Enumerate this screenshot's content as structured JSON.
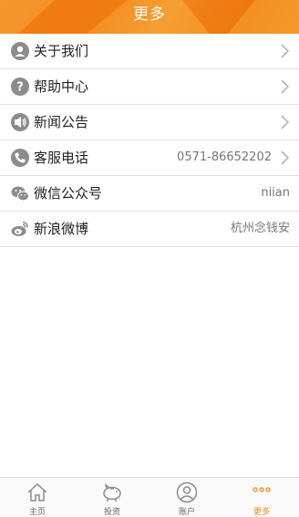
{
  "header": {
    "title": "更多"
  },
  "menu": {
    "items": [
      {
        "label": "关于我们",
        "icon": "about-icon"
      },
      {
        "label": "帮助中心",
        "icon": "help-icon"
      },
      {
        "label": "新闻公告",
        "icon": "announcement-icon"
      },
      {
        "label": "客服电话",
        "value": "0571-86652202",
        "icon": "phone-icon"
      },
      {
        "label": "微信公众号",
        "value": "niian",
        "icon": "wechat-icon"
      },
      {
        "label": "新浪微博",
        "value": "杭州念钱安",
        "icon": "weibo-icon"
      }
    ]
  },
  "tabbar": {
    "tabs": [
      {
        "label": "主页",
        "icon": "home-icon"
      },
      {
        "label": "投资",
        "icon": "piggy-bank-icon"
      },
      {
        "label": "账户",
        "icon": "account-icon"
      },
      {
        "label": "更多",
        "icon": "more-icon",
        "active": true
      }
    ]
  },
  "colors": {
    "accent": "#f08a1c",
    "icon_gray": "#8c8c8c"
  }
}
